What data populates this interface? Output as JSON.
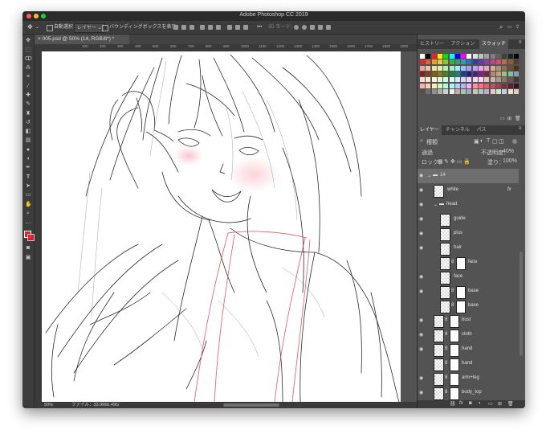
{
  "window": {
    "title": "Adobe Photoshop CC 2019"
  },
  "options_bar": {
    "auto_select_label": "自動選択：",
    "layer_dropdown": "レイヤー",
    "bounding_box_label": "バウンディングボックスを表示",
    "mode_3d_label": "3D モード："
  },
  "document": {
    "tab_title": "005.psd @ 50% (14, RGB/8*) *",
    "zoom": "50%",
    "file_info": "ファイル：33.9M/1.49G",
    "ruler_marks": [
      "100",
      "200",
      "300",
      "400",
      "500",
      "600",
      "700",
      "800",
      "900",
      "1000",
      "1100",
      "1200",
      "1300",
      "1400",
      "1500",
      "1600",
      "1700",
      "1800",
      "1900",
      "2000"
    ]
  },
  "top_panel": {
    "tabs": [
      "ヒストリー",
      "アクション",
      "スウォッチ"
    ],
    "active_tab": "スウォッチ",
    "swatch_colors": [
      [
        "#ffffff",
        "#000000",
        "#ff2020",
        "#ffee00",
        "#00e000",
        "#00ffff",
        "#0000ff",
        "#ff00ff",
        "#ffffff",
        "#e0e0e0",
        "#c0c0c0",
        "#a0a0a0",
        "#808080",
        "#606060",
        "#404040",
        "#202020",
        "#000000"
      ],
      [
        "#d03030",
        "#e06030",
        "#e8a030",
        "#e0d040",
        "#90c040",
        "#40b040",
        "#30a070",
        "#30a0a0",
        "#3070c0",
        "#3040a0",
        "#6040a0",
        "#9040a0",
        "#c04090",
        "#d05070",
        "#b07050",
        "#806040",
        "#504030"
      ],
      [
        "#f0a0a0",
        "#f0c0a0",
        "#f0e0a0",
        "#e0f0a0",
        "#b0f0a0",
        "#a0f0c0",
        "#a0f0f0",
        "#a0c0f0",
        "#a0a0f0",
        "#c0a0f0",
        "#f0a0f0",
        "#f0a0c0",
        "#d0b090",
        "#b09070",
        "#907050",
        "#705030",
        "#503010"
      ],
      [
        "#802020",
        "#804020",
        "#806020",
        "#808020",
        "#508020",
        "#208040",
        "#208080",
        "#204080",
        "#202080",
        "#502080",
        "#802080",
        "#802050",
        "#c08080",
        "#c0a080",
        "#a0c080",
        "#80c0a0",
        "#80a0c0"
      ],
      [
        "#f8d8d8",
        "#f8e8d8",
        "#f8f8d8",
        "#e8f8d8",
        "#d8f8e8",
        "#d8f8f8",
        "#d8e8f8",
        "#d8d8f8",
        "#e8d8f8",
        "#f8d8f8",
        "#f8d8e8",
        "#e0c8b8",
        "#c8b8a8",
        "#a89888",
        "#887868",
        "#685848",
        "#483828"
      ],
      [
        "#ffb0b0",
        "#ffd0b0",
        "#fff0b0",
        "#d0ffb0",
        "#b0ffd0",
        "#b0f0ff",
        "#b0d0ff",
        "#c0b0ff",
        "#f0b0ff",
        "#ff90a0",
        "#ff7080",
        "#e06070",
        "#c05060",
        "#a04050",
        "#803040",
        "#602030",
        "#401020"
      ],
      [
        "#505050",
        "#707070",
        "#909090",
        "#b0b0b0",
        "#d0d0d0",
        "#f0f0f0",
        "#c8a8a8",
        "#a8c8a8",
        "#a8a8c8",
        "#c8c8a8",
        "#a8c8c8",
        "#c8a8c8",
        "#e8c8c8",
        "#c8e8c8",
        "#c8c8e8",
        "#f0e0d0",
        "#e0d0c0"
      ]
    ]
  },
  "layers_panel": {
    "tabs": [
      "レイヤー",
      "チャンネル",
      "パス"
    ],
    "active_tab": "レイヤー",
    "filter_kind": "種類",
    "blend_mode": "通過",
    "opacity_label": "不透明度：",
    "opacity_value": "40%",
    "lock_label": "ロック：",
    "fill_label": "塗り：",
    "fill_value": "100%",
    "layers": [
      {
        "name": "14",
        "type": "group",
        "visible": true,
        "indent": 0,
        "selected": true,
        "mask": false
      },
      {
        "name": "white",
        "type": "layer",
        "visible": true,
        "indent": 1,
        "selected": false,
        "mask": false,
        "fx": true
      },
      {
        "name": "head",
        "type": "group",
        "visible": true,
        "indent": 1,
        "selected": false,
        "mask": false
      },
      {
        "name": "guide",
        "type": "layer",
        "visible": true,
        "indent": 2,
        "selected": false,
        "mask": false
      },
      {
        "name": "plus",
        "type": "layer",
        "visible": true,
        "indent": 2,
        "selected": false,
        "mask": false
      },
      {
        "name": "hair",
        "type": "layer",
        "visible": true,
        "indent": 2,
        "selected": false,
        "mask": false
      },
      {
        "name": "face",
        "type": "layer",
        "visible": false,
        "indent": 2,
        "selected": false,
        "mask": true
      },
      {
        "name": "face",
        "type": "layer",
        "visible": true,
        "indent": 2,
        "selected": false,
        "mask": false
      },
      {
        "name": "base",
        "type": "layer",
        "visible": true,
        "indent": 2,
        "selected": false,
        "mask": true
      },
      {
        "name": "base",
        "type": "layer",
        "visible": false,
        "indent": 2,
        "selected": false,
        "mask": true
      },
      {
        "name": "bust",
        "type": "layer",
        "visible": true,
        "indent": 1,
        "selected": false,
        "mask": true
      },
      {
        "name": "cloth",
        "type": "layer",
        "visible": true,
        "indent": 1,
        "selected": false,
        "mask": true
      },
      {
        "name": "hand",
        "type": "layer",
        "visible": true,
        "indent": 1,
        "selected": false,
        "mask": true
      },
      {
        "name": "hand",
        "type": "layer",
        "visible": false,
        "indent": 1,
        "selected": false,
        "mask": true
      },
      {
        "name": "arm+leg",
        "type": "layer",
        "visible": true,
        "indent": 1,
        "selected": false,
        "mask": true
      },
      {
        "name": "body_top",
        "type": "layer",
        "visible": true,
        "indent": 1,
        "selected": false,
        "mask": true
      }
    ]
  },
  "colors": {
    "foreground": "#e02030",
    "background": "#ffffff"
  }
}
